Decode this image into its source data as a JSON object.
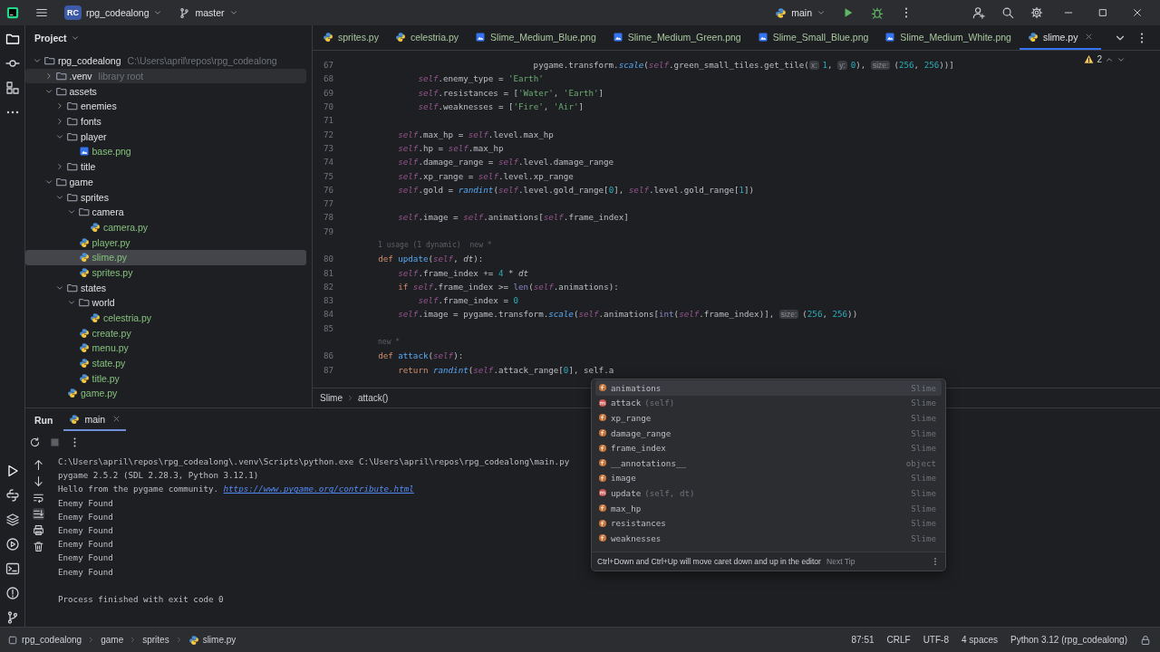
{
  "title_bar": {
    "project_badge": "RC",
    "project": "rpg_codealong",
    "branch": "master",
    "run_config": "main"
  },
  "project_panel": {
    "title": "Project",
    "tree": [
      {
        "name": "rpg_codealong",
        "kind": "folder",
        "expanded": true,
        "selected": false,
        "hint": "C:\\Users\\april\\repos\\rpg_codealong",
        "children": [
          {
            "name": ".venv",
            "kind": "folder",
            "expanded": false,
            "selected": false,
            "hovered": true,
            "hint": "library root"
          },
          {
            "name": "assets",
            "kind": "folder",
            "expanded": true,
            "selected": false,
            "children": [
              {
                "name": "enemies",
                "kind": "folder",
                "expanded": false,
                "selected": false
              },
              {
                "name": "fonts",
                "kind": "folder",
                "expanded": false,
                "selected": false
              },
              {
                "name": "player",
                "kind": "folder",
                "expanded": true,
                "selected": false,
                "children": [
                  {
                    "name": "base.png",
                    "kind": "image",
                    "selected": false
                  }
                ]
              },
              {
                "name": "title",
                "kind": "folder",
                "expanded": false,
                "selected": false
              }
            ]
          },
          {
            "name": "game",
            "kind": "folder",
            "expanded": true,
            "selected": false,
            "children": [
              {
                "name": "sprites",
                "kind": "folder",
                "expanded": true,
                "selected": false,
                "children": [
                  {
                    "name": "camera",
                    "kind": "folder",
                    "expanded": true,
                    "selected": false,
                    "children": [
                      {
                        "name": "camera.py",
                        "kind": "python",
                        "selected": false
                      }
                    ]
                  },
                  {
                    "name": "player.py",
                    "kind": "python",
                    "selected": false
                  },
                  {
                    "name": "slime.py",
                    "kind": "python",
                    "selected": true
                  },
                  {
                    "name": "sprites.py",
                    "kind": "python",
                    "selected": false
                  }
                ]
              },
              {
                "name": "states",
                "kind": "folder",
                "expanded": true,
                "selected": false,
                "children": [
                  {
                    "name": "world",
                    "kind": "folder",
                    "expanded": true,
                    "selected": false,
                    "children": [
                      {
                        "name": "celestria.py",
                        "kind": "python",
                        "selected": false
                      }
                    ]
                  },
                  {
                    "name": "create.py",
                    "kind": "python",
                    "selected": false
                  },
                  {
                    "name": "menu.py",
                    "kind": "python",
                    "selected": false
                  },
                  {
                    "name": "state.py",
                    "kind": "python",
                    "selected": false
                  },
                  {
                    "name": "title.py",
                    "kind": "python",
                    "selected": false
                  }
                ]
              },
              {
                "name": "game.py",
                "kind": "python",
                "selected": false
              }
            ]
          }
        ]
      }
    ]
  },
  "editor_tabs": [
    {
      "label": "sprites.py",
      "kind": "python",
      "selected": false
    },
    {
      "label": "celestria.py",
      "kind": "python",
      "selected": false
    },
    {
      "label": "Slime_Medium_Blue.png",
      "kind": "image",
      "selected": false
    },
    {
      "label": "Slime_Medium_Green.png",
      "kind": "image",
      "selected": false
    },
    {
      "label": "Slime_Small_Blue.png",
      "kind": "image",
      "selected": false
    },
    {
      "label": "Slime_Medium_White.png",
      "kind": "image",
      "selected": false
    },
    {
      "label": "slime.py",
      "kind": "python",
      "selected": true
    }
  ],
  "editor": {
    "problems": "2",
    "lines": [
      {
        "kind": "code",
        "number": "67",
        "tokens": [
          {
            "kind": "plain",
            "text": "                                   pygame.transform."
          },
          {
            "kind": "call",
            "text": "scale"
          },
          {
            "kind": "plain",
            "text": "("
          },
          {
            "kind": "self",
            "text": "self"
          },
          {
            "kind": "plain",
            "text": ".green_small_tiles.get_tile("
          },
          {
            "kind": "hint",
            "text": "x:"
          },
          {
            "kind": "number",
            "text": "1"
          },
          {
            "kind": "plain",
            "text": ", "
          },
          {
            "kind": "hint",
            "text": "y:"
          },
          {
            "kind": "number",
            "text": "0"
          },
          {
            "kind": "plain",
            "text": "), "
          },
          {
            "kind": "hint",
            "text": "size:"
          },
          {
            "kind": "plain",
            "text": "("
          },
          {
            "kind": "number",
            "text": "256"
          },
          {
            "kind": "plain",
            "text": ", "
          },
          {
            "kind": "number",
            "text": "256"
          },
          {
            "kind": "plain",
            "text": "))]"
          }
        ]
      },
      {
        "kind": "code",
        "number": "68",
        "tokens": [
          {
            "kind": "self",
            "text": "            self"
          },
          {
            "kind": "plain",
            "text": ".enemy_type = "
          },
          {
            "kind": "string",
            "text": "'Earth'"
          }
        ]
      },
      {
        "kind": "code",
        "number": "69",
        "tokens": [
          {
            "kind": "self",
            "text": "            self"
          },
          {
            "kind": "plain",
            "text": ".resistances = ["
          },
          {
            "kind": "string",
            "text": "'Water'"
          },
          {
            "kind": "plain",
            "text": ", "
          },
          {
            "kind": "string",
            "text": "'Earth'"
          },
          {
            "kind": "plain",
            "text": "]"
          }
        ]
      },
      {
        "kind": "code",
        "number": "70",
        "tokens": [
          {
            "kind": "self",
            "text": "            self"
          },
          {
            "kind": "plain",
            "text": ".weaknesses = ["
          },
          {
            "kind": "string",
            "text": "'Fire'"
          },
          {
            "kind": "plain",
            "text": ", "
          },
          {
            "kind": "string",
            "text": "'Air'"
          },
          {
            "kind": "plain",
            "text": "]"
          }
        ]
      },
      {
        "kind": "code",
        "number": "71"
      },
      {
        "kind": "code",
        "number": "72",
        "tokens": [
          {
            "kind": "self",
            "text": "        self"
          },
          {
            "kind": "plain",
            "text": ".max_hp = "
          },
          {
            "kind": "self",
            "text": "self"
          },
          {
            "kind": "plain",
            "text": ".level.max_hp"
          }
        ]
      },
      {
        "kind": "code",
        "number": "73",
        "tokens": [
          {
            "kind": "self",
            "text": "        self"
          },
          {
            "kind": "plain",
            "text": ".hp = "
          },
          {
            "kind": "self",
            "text": "self"
          },
          {
            "kind": "plain",
            "text": ".max_hp"
          }
        ]
      },
      {
        "kind": "code",
        "number": "74",
        "tokens": [
          {
            "kind": "self",
            "text": "        self"
          },
          {
            "kind": "plain",
            "text": ".damage_range = "
          },
          {
            "kind": "self",
            "text": "self"
          },
          {
            "kind": "plain",
            "text": ".level.damage_range"
          }
        ]
      },
      {
        "kind": "code",
        "number": "75",
        "tokens": [
          {
            "kind": "self",
            "text": "        self"
          },
          {
            "kind": "plain",
            "text": ".xp_range = "
          },
          {
            "kind": "self",
            "text": "self"
          },
          {
            "kind": "plain",
            "text": ".level.xp_range"
          }
        ]
      },
      {
        "kind": "code",
        "number": "76",
        "tokens": [
          {
            "kind": "self",
            "text": "        self"
          },
          {
            "kind": "plain",
            "text": ".gold = "
          },
          {
            "kind": "call",
            "text": "randint"
          },
          {
            "kind": "plain",
            "text": "("
          },
          {
            "kind": "self",
            "text": "self"
          },
          {
            "kind": "plain",
            "text": ".level.gold_range["
          },
          {
            "kind": "number",
            "text": "0"
          },
          {
            "kind": "plain",
            "text": "], "
          },
          {
            "kind": "self",
            "text": "self"
          },
          {
            "kind": "plain",
            "text": ".level.gold_range["
          },
          {
            "kind": "number",
            "text": "1"
          },
          {
            "kind": "plain",
            "text": "])"
          }
        ]
      },
      {
        "kind": "code",
        "number": "77"
      },
      {
        "kind": "code",
        "number": "78",
        "tokens": [
          {
            "kind": "self",
            "text": "        self"
          },
          {
            "kind": "plain",
            "text": ".image = "
          },
          {
            "kind": "self",
            "text": "self"
          },
          {
            "kind": "plain",
            "text": ".animations["
          },
          {
            "kind": "self",
            "text": "self"
          },
          {
            "kind": "plain",
            "text": ".frame_index]"
          }
        ]
      },
      {
        "kind": "code",
        "number": "79"
      },
      {
        "kind": "annotation",
        "parts": [
          "1 usage (1 dynamic)",
          "new *"
        ]
      },
      {
        "kind": "code",
        "number": "80",
        "tokens": [
          {
            "kind": "keyword",
            "text": "    def "
          },
          {
            "kind": "defname",
            "text": "update"
          },
          {
            "kind": "plain",
            "text": "("
          },
          {
            "kind": "self",
            "text": "self"
          },
          {
            "kind": "plain",
            "text": ", "
          },
          {
            "kind": "param",
            "text": "dt"
          },
          {
            "kind": "plain",
            "text": "):"
          }
        ]
      },
      {
        "kind": "code",
        "number": "81",
        "tokens": [
          {
            "kind": "self",
            "text": "        self"
          },
          {
            "kind": "plain",
            "text": ".frame_index += "
          },
          {
            "kind": "number",
            "text": "4"
          },
          {
            "kind": "plain",
            "text": " * "
          },
          {
            "kind": "param",
            "text": "dt"
          }
        ]
      },
      {
        "kind": "code",
        "number": "82",
        "tokens": [
          {
            "kind": "keyword",
            "text": "        if "
          },
          {
            "kind": "self",
            "text": "self"
          },
          {
            "kind": "plain",
            "text": ".frame_index >= "
          },
          {
            "kind": "builtin",
            "text": "len"
          },
          {
            "kind": "plain",
            "text": "("
          },
          {
            "kind": "self",
            "text": "self"
          },
          {
            "kind": "plain",
            "text": ".animations):"
          }
        ]
      },
      {
        "kind": "code",
        "number": "83",
        "tokens": [
          {
            "kind": "self",
            "text": "            self"
          },
          {
            "kind": "plain",
            "text": ".frame_index = "
          },
          {
            "kind": "number",
            "text": "0"
          }
        ]
      },
      {
        "kind": "code",
        "number": "84",
        "tokens": [
          {
            "kind": "self",
            "text": "        self"
          },
          {
            "kind": "plain",
            "text": ".image = pygame.transform."
          },
          {
            "kind": "call",
            "text": "scale"
          },
          {
            "kind": "plain",
            "text": "("
          },
          {
            "kind": "self",
            "text": "self"
          },
          {
            "kind": "plain",
            "text": ".animations["
          },
          {
            "kind": "builtin",
            "text": "int"
          },
          {
            "kind": "plain",
            "text": "("
          },
          {
            "kind": "self",
            "text": "self"
          },
          {
            "kind": "plain",
            "text": ".frame_index)], "
          },
          {
            "kind": "hint",
            "text": "size:"
          },
          {
            "kind": "plain",
            "text": "("
          },
          {
            "kind": "number",
            "text": "256"
          },
          {
            "kind": "plain",
            "text": ", "
          },
          {
            "kind": "number",
            "text": "256"
          },
          {
            "kind": "plain",
            "text": "))"
          }
        ]
      },
      {
        "kind": "code",
        "number": "85"
      },
      {
        "kind": "annotation",
        "parts": [
          "new *"
        ]
      },
      {
        "kind": "code",
        "number": "86",
        "tokens": [
          {
            "kind": "keyword",
            "text": "    def "
          },
          {
            "kind": "defname",
            "text": "attack"
          },
          {
            "kind": "plain",
            "text": "("
          },
          {
            "kind": "self",
            "text": "self"
          },
          {
            "kind": "plain",
            "text": "):"
          }
        ]
      },
      {
        "kind": "code",
        "number": "87",
        "tokens": [
          {
            "kind": "keyword",
            "text": "        return "
          },
          {
            "kind": "call",
            "text": "randint"
          },
          {
            "kind": "plain",
            "text": "("
          },
          {
            "kind": "self",
            "text": "self"
          },
          {
            "kind": "plain",
            "text": ".attack_range["
          },
          {
            "kind": "number",
            "text": "0"
          },
          {
            "kind": "plain",
            "text": "], self.a"
          }
        ]
      }
    ]
  },
  "breadcrumb": [
    "Slime",
    "attack()"
  ],
  "completion": {
    "items": [
      {
        "kind": "field",
        "name": "animations",
        "type": "Slime",
        "selected": true
      },
      {
        "kind": "method",
        "name": "attack",
        "params": "(self)",
        "type": "Slime",
        "selected": false
      },
      {
        "kind": "field",
        "name": "xp_range",
        "type": "Slime",
        "selected": false
      },
      {
        "kind": "field",
        "name": "damage_range",
        "type": "Slime",
        "selected": false
      },
      {
        "kind": "field",
        "name": "frame_index",
        "type": "Slime",
        "selected": false
      },
      {
        "kind": "field",
        "name": "__annotations__",
        "type": "object",
        "selected": false
      },
      {
        "kind": "field",
        "name": "image",
        "type": "Slime",
        "selected": false
      },
      {
        "kind": "method",
        "name": "update",
        "params": "(self, dt)",
        "type": "Slime",
        "selected": false
      },
      {
        "kind": "field",
        "name": "max_hp",
        "type": "Slime",
        "selected": false
      },
      {
        "kind": "field",
        "name": "resistances",
        "type": "Slime",
        "selected": false
      },
      {
        "kind": "field",
        "name": "weaknesses",
        "type": "Slime",
        "selected": false
      }
    ],
    "tip": "Ctrl+Down and Ctrl+Up will move caret down and up in the editor",
    "tip_link": "Next Tip"
  },
  "run_panel": {
    "title": "Run",
    "tabs": [
      {
        "label": "main",
        "selected": true
      }
    ],
    "console": [
      {
        "kind": "output",
        "parts": [
          {
            "kind": "text",
            "text": "C:\\Users\\april\\repos\\rpg_codealong\\.venv\\Scripts\\python.exe C:\\Users\\april\\repos\\rpg_codealong\\main.py"
          }
        ]
      },
      {
        "kind": "output",
        "parts": [
          {
            "kind": "text",
            "text": "pygame 2.5.2 (SDL 2.28.3, Python 3.12.1)"
          }
        ]
      },
      {
        "kind": "output",
        "parts": [
          {
            "kind": "text",
            "text": "Hello from the pygame community. "
          },
          {
            "kind": "link",
            "text": "https://www.pygame.org/contribute.html"
          }
        ]
      },
      {
        "kind": "output",
        "parts": [
          {
            "kind": "text",
            "text": "Enemy Found"
          }
        ]
      },
      {
        "kind": "output",
        "parts": [
          {
            "kind": "text",
            "text": "Enemy Found"
          }
        ]
      },
      {
        "kind": "output",
        "parts": [
          {
            "kind": "text",
            "text": "Enemy Found"
          }
        ]
      },
      {
        "kind": "output",
        "parts": [
          {
            "kind": "text",
            "text": "Enemy Found"
          }
        ]
      },
      {
        "kind": "output",
        "parts": [
          {
            "kind": "text",
            "text": "Enemy Found"
          }
        ]
      },
      {
        "kind": "output",
        "parts": [
          {
            "kind": "text",
            "text": "Enemy Found"
          }
        ]
      },
      {
        "kind": "blank"
      },
      {
        "kind": "output",
        "parts": [
          {
            "kind": "text",
            "text": "Process finished with exit code 0"
          }
        ]
      }
    ]
  },
  "status_bar": {
    "path": [
      {
        "label": "rpg_codealong",
        "kind": "project"
      },
      {
        "label": "game",
        "kind": "folder"
      },
      {
        "label": "sprites",
        "kind": "folder"
      },
      {
        "label": "slime.py",
        "kind": "python"
      }
    ],
    "items": [
      "87:51",
      "CRLF",
      "UTF-8",
      "4 spaces",
      "Python 3.12 (rpg_codealong)"
    ]
  }
}
